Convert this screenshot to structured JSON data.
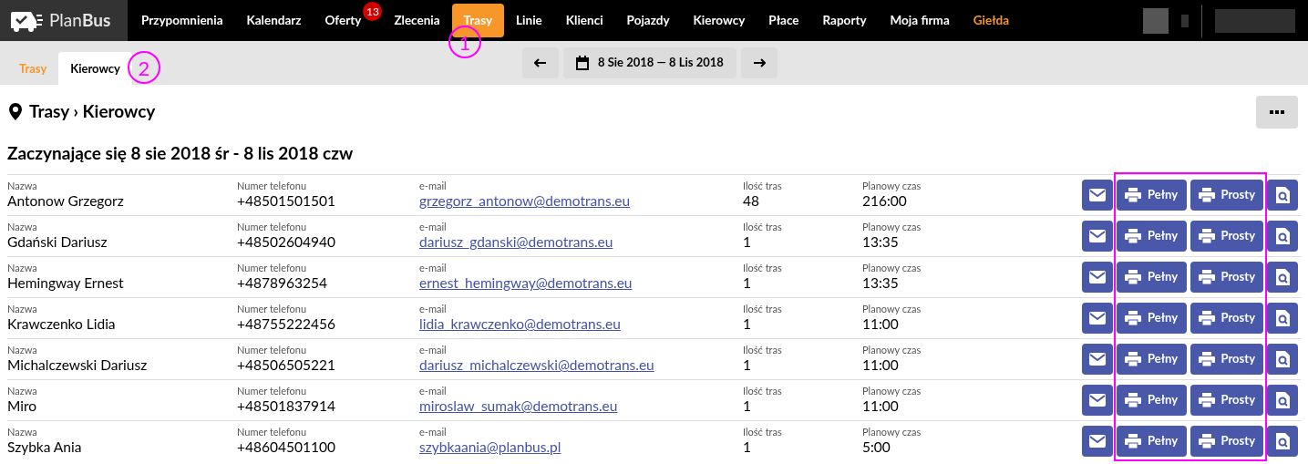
{
  "brand": {
    "plain": "Plan",
    "bold": "Bus"
  },
  "nav": [
    {
      "label": "Przypomnienia",
      "selected": false
    },
    {
      "label": "Kalendarz",
      "selected": false
    },
    {
      "label": "Oferty",
      "selected": false,
      "badge": "13"
    },
    {
      "label": "Zlecenia",
      "selected": false
    },
    {
      "label": "Trasy",
      "selected": true
    },
    {
      "label": "Linie",
      "selected": false
    },
    {
      "label": "Klienci",
      "selected": false
    },
    {
      "label": "Pojazdy",
      "selected": false
    },
    {
      "label": "Kierowcy",
      "selected": false
    },
    {
      "label": "Płace",
      "selected": false
    },
    {
      "label": "Raporty",
      "selected": false
    },
    {
      "label": "Moja firma",
      "selected": false
    },
    {
      "label": "Giełda",
      "selected": false,
      "kind": "accent"
    }
  ],
  "subtabs": [
    {
      "label": "Trasy",
      "selected": false
    },
    {
      "label": "Kierowcy",
      "selected": true
    }
  ],
  "date_range": "8 Sie 2018 — 8 Lis 2018",
  "breadcrumb": "Trasy › Kierowcy",
  "heading": "Zaczynające się 8 sie 2018 śr - 8 lis 2018 czw",
  "rows": [
    {
      "fields": [
        {
          "label": "Nazwa",
          "value": "Antonow Grzegorz"
        },
        {
          "label": "Numer telefonu",
          "value": "+48501501501"
        },
        {
          "label": "e-mail",
          "value": "grzegorz_antonow@demotrans.eu",
          "kind": "link"
        },
        {
          "label": "Ilość tras",
          "value": "48"
        },
        {
          "label": "Planowy czas",
          "value": "216:00"
        }
      ],
      "actions": [
        {
          "kind": "mail"
        },
        {
          "kind": "print",
          "label": "Pełny"
        },
        {
          "kind": "print",
          "label": "Prosty"
        },
        {
          "kind": "preview"
        }
      ]
    },
    {
      "fields": [
        {
          "label": "Nazwa",
          "value": "Gdański Dariusz"
        },
        {
          "label": "Numer telefonu",
          "value": "+48502604940"
        },
        {
          "label": "e-mail",
          "value": "dariusz_gdanski@demotrans.eu",
          "kind": "link"
        },
        {
          "label": "Ilość tras",
          "value": "1"
        },
        {
          "label": "Planowy czas",
          "value": "13:35"
        }
      ],
      "actions": [
        {
          "kind": "mail"
        },
        {
          "kind": "print",
          "label": "Pełny"
        },
        {
          "kind": "print",
          "label": "Prosty"
        },
        {
          "kind": "preview"
        }
      ]
    },
    {
      "fields": [
        {
          "label": "Nazwa",
          "value": "Hemingway Ernest"
        },
        {
          "label": "Numer telefonu",
          "value": "+4878963254"
        },
        {
          "label": "e-mail",
          "value": "ernest_hemingway@demotrans.eu",
          "kind": "link"
        },
        {
          "label": "Ilość tras",
          "value": "1"
        },
        {
          "label": "Planowy czas",
          "value": "13:35"
        }
      ],
      "actions": [
        {
          "kind": "mail"
        },
        {
          "kind": "print",
          "label": "Pełny"
        },
        {
          "kind": "print",
          "label": "Prosty"
        },
        {
          "kind": "preview"
        }
      ]
    },
    {
      "fields": [
        {
          "label": "Nazwa",
          "value": "Krawczenko Lidia"
        },
        {
          "label": "Numer telefonu",
          "value": "+48755222456"
        },
        {
          "label": "e-mail",
          "value": "lidia_krawczenko@demotrans.eu",
          "kind": "link"
        },
        {
          "label": "Ilość tras",
          "value": "1"
        },
        {
          "label": "Planowy czas",
          "value": "11:00"
        }
      ],
      "actions": [
        {
          "kind": "mail"
        },
        {
          "kind": "print",
          "label": "Pełny"
        },
        {
          "kind": "print",
          "label": "Prosty"
        },
        {
          "kind": "preview"
        }
      ]
    },
    {
      "fields": [
        {
          "label": "Nazwa",
          "value": "Michalczewski Dariusz"
        },
        {
          "label": "Numer telefonu",
          "value": "+48506505221"
        },
        {
          "label": "e-mail",
          "value": "dariusz_michalczewski@demotrans.eu",
          "kind": "link"
        },
        {
          "label": "Ilość tras",
          "value": "1"
        },
        {
          "label": "Planowy czas",
          "value": "11:00"
        }
      ],
      "actions": [
        {
          "kind": "mail"
        },
        {
          "kind": "print",
          "label": "Pełny"
        },
        {
          "kind": "print",
          "label": "Prosty"
        },
        {
          "kind": "preview"
        }
      ]
    },
    {
      "fields": [
        {
          "label": "Nazwa",
          "value": "Miro"
        },
        {
          "label": "Numer telefonu",
          "value": "+48501837914"
        },
        {
          "label": "e-mail",
          "value": "miroslaw_sumak@demotrans.eu",
          "kind": "link"
        },
        {
          "label": "Ilość tras",
          "value": "1"
        },
        {
          "label": "Planowy czas",
          "value": "11:00"
        }
      ],
      "actions": [
        {
          "kind": "mail"
        },
        {
          "kind": "print",
          "label": "Pełny"
        },
        {
          "kind": "print",
          "label": "Prosty"
        },
        {
          "kind": "preview"
        }
      ]
    },
    {
      "fields": [
        {
          "label": "Nazwa",
          "value": "Szybka Ania"
        },
        {
          "label": "Numer telefonu",
          "value": "+48604501100"
        },
        {
          "label": "e-mail",
          "value": "szybkaania@planbus.pl",
          "kind": "link"
        },
        {
          "label": "Ilość tras",
          "value": "1"
        },
        {
          "label": "Planowy czas",
          "value": "5:00"
        }
      ],
      "actions": [
        {
          "kind": "mail"
        },
        {
          "kind": "print",
          "label": "Pełny"
        },
        {
          "kind": "print",
          "label": "Prosty"
        },
        {
          "kind": "preview"
        }
      ]
    }
  ],
  "annotations": [
    {
      "kind": "circle",
      "label": "1"
    },
    {
      "kind": "circle",
      "label": "2"
    },
    {
      "kind": "rect"
    }
  ]
}
